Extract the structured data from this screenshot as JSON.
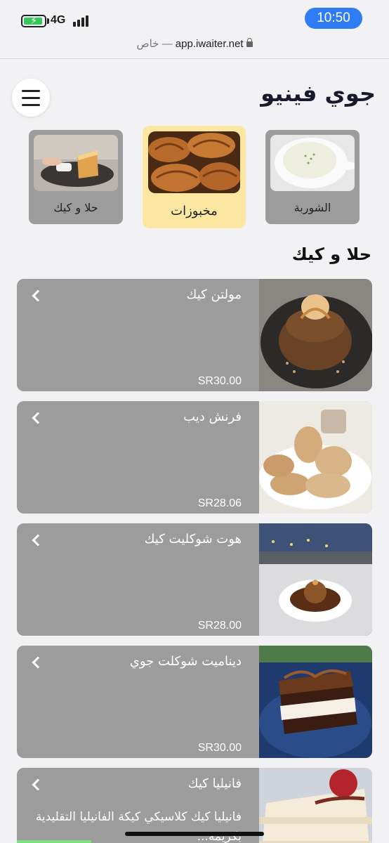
{
  "status_bar": {
    "network": "4G",
    "time": "10:50"
  },
  "url_bar": {
    "private_label": "خاص —",
    "host": "app.iwaiter.net"
  },
  "header": {
    "title": "جوي فينيو"
  },
  "categories": [
    {
      "label": "حلا و كيك",
      "selected": false
    },
    {
      "label": "مخبوزات",
      "selected": true
    },
    {
      "label": "الشوربة",
      "selected": false
    }
  ],
  "section": {
    "title": "حلا و كيك"
  },
  "items": [
    {
      "name": "مولتن كيك",
      "price": "SR30.00"
    },
    {
      "name": "فرنش ديب",
      "price": "SR28.06"
    },
    {
      "name": "هوت شوكليت كيك",
      "price": "SR28.00"
    },
    {
      "name": "ديناميت شوكلت جوي",
      "price": "SR30.00"
    },
    {
      "name": "فانيليا كيك",
      "description": "فانيليا كيك كلاسيكي كيكة الفانيليا التقليدية بكريمة..."
    }
  ],
  "colors": {
    "accent": "#2f7cf6",
    "card": "#9c9c9c",
    "selected_category": "#fbe7a2"
  }
}
